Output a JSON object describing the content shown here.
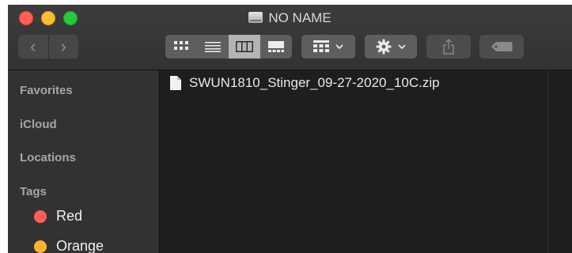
{
  "window": {
    "title": "NO NAME",
    "title_icon": "external-drive-icon"
  },
  "toolbar": {
    "back_glyph": "‹",
    "forward_glyph": "›",
    "view_modes": [
      "icon-view",
      "list-view",
      "column-view",
      "gallery-view"
    ],
    "active_view": "column-view",
    "group_icon": "group-by-icon",
    "action_icon": "gear-icon",
    "share_icon": "share-icon",
    "tag_icon": "tag-icon"
  },
  "sidebar": {
    "sections": [
      "Favorites",
      "iCloud",
      "Locations",
      "Tags"
    ],
    "tags": [
      {
        "label": "Red",
        "color": "#ff5f57"
      },
      {
        "label": "Orange",
        "color": "#fbb52b"
      }
    ]
  },
  "files": [
    {
      "name": "SWUN1810_Stinger_09-27-2020_10C.zip",
      "icon": "zip-document-icon"
    }
  ],
  "colors": {
    "window_bg": "#1e1e1e",
    "sidebar_bg": "#323232",
    "toolbar_active": "#b4b4b4"
  }
}
